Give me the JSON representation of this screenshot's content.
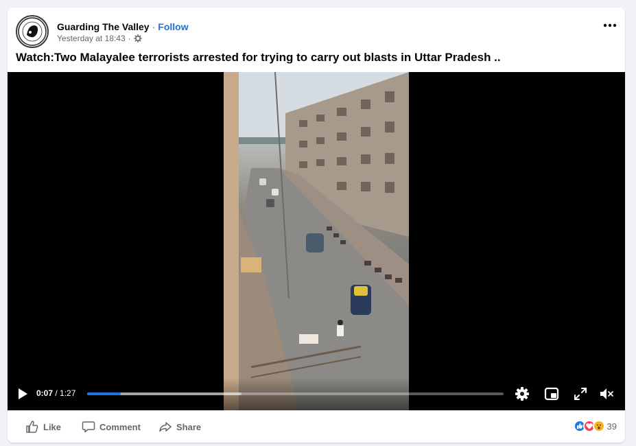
{
  "post": {
    "page_name": "Guarding The Valley",
    "separator": "·",
    "follow_label": "Follow",
    "timestamp": "Yesterday at 18:43",
    "caption": "Watch:Two Malayalee terrorists arrested for trying to carry out blasts in Uttar Pradesh .."
  },
  "video": {
    "current_time": "0:07",
    "time_separator": " / ",
    "duration": "1:27",
    "progress_fraction": 0.08,
    "buffered_fraction": 0.37,
    "accent_color": "#1b74e4"
  },
  "actions": {
    "like_label": "Like",
    "comment_label": "Comment",
    "share_label": "Share",
    "reaction_count": "39"
  },
  "colors": {
    "link": "#216fdb",
    "secondary_text": "#65676b",
    "like_blue": "#1877f2",
    "love_red": "#f33e58",
    "wow_yellow": "#f7b125"
  }
}
